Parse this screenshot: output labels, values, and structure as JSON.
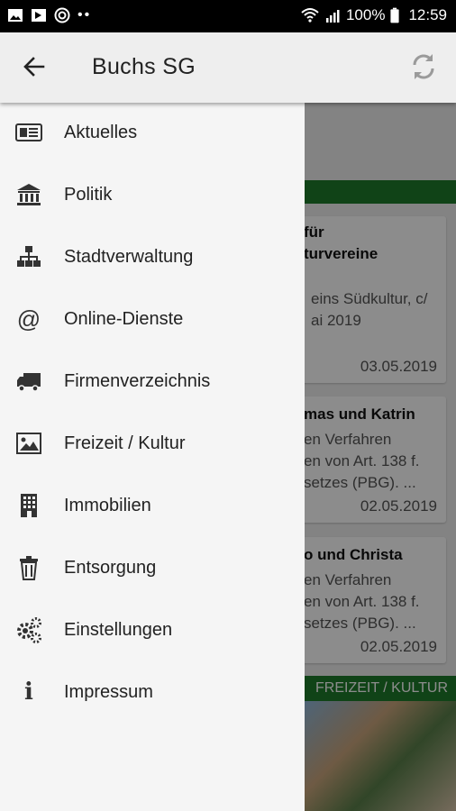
{
  "status_bar": {
    "battery": "100%",
    "time": "12:59"
  },
  "app_bar": {
    "title": "Buchs SG"
  },
  "drawer": {
    "items": [
      {
        "label": "Aktuelles",
        "icon": "newspaper-icon"
      },
      {
        "label": "Politik",
        "icon": "bank-icon"
      },
      {
        "label": "Stadtverwaltung",
        "icon": "sitemap-icon"
      },
      {
        "label": "Online-Dienste",
        "icon": "at-icon"
      },
      {
        "label": "Firmenverzeichnis",
        "icon": "truck-icon"
      },
      {
        "label": "Freizeit / Kultur",
        "icon": "image-icon"
      },
      {
        "label": "Immobilien",
        "icon": "building-icon"
      },
      {
        "label": "Entsorgung",
        "icon": "trash-icon"
      },
      {
        "label": "Einstellungen",
        "icon": "cogs-icon"
      },
      {
        "label": "Impressum",
        "icon": "info-icon"
      }
    ]
  },
  "background": {
    "cards": [
      {
        "title_lines": [
          "für",
          "turvereine"
        ],
        "desc_lines": [
          "eins Südkultur, c/",
          "ai 2019"
        ],
        "date": "03.05.2019"
      },
      {
        "title_lines": [
          "mas und Katrin"
        ],
        "desc_lines": [
          "en Verfahren",
          "en von Art. 138 f.",
          "setzes (PBG). ..."
        ],
        "date": "02.05.2019"
      },
      {
        "title_lines": [
          "o und Christa"
        ],
        "desc_lines": [
          "en Verfahren",
          "en von Art. 138 f.",
          "setzes (PBG). ..."
        ],
        "date": "02.05.2019"
      }
    ],
    "category_label": "FREIZEIT / KULTUR"
  },
  "colors": {
    "accent_green": "#1e7a2a",
    "drawer_bg": "#f5f5f5",
    "appbar_bg": "#eeeeee"
  }
}
